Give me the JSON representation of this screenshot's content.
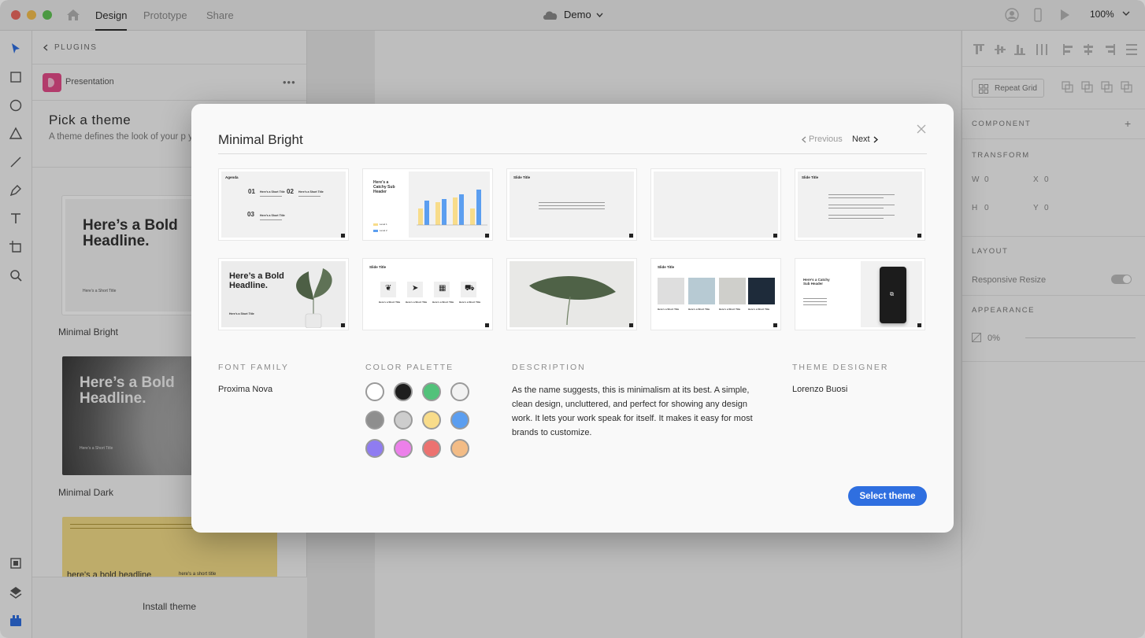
{
  "titlebar": {
    "tabs": [
      "Design",
      "Prototype",
      "Share"
    ],
    "document": "Demo",
    "zoom": "100%"
  },
  "plugin_panel": {
    "back_label": "PLUGINS",
    "plugin_name": "Presentation",
    "more": "•••",
    "pick_title": "Pick a theme",
    "pick_description": "A theme defines the look of your p your theme at any time.",
    "themes": [
      {
        "name": "Minimal Bright",
        "headline": "Here’s a Bold Headline.",
        "subtitle": "Here’s a Short Title"
      },
      {
        "name": "Minimal Dark",
        "headline": "Here’s a Bold Headline.",
        "subtitle": "Here’s a Short Title"
      },
      {
        "name": "",
        "headline": "here's a bold headline",
        "subtitle": "here's a short title"
      }
    ],
    "install_label": "Install theme"
  },
  "right_panel": {
    "repeat_grid": "Repeat Grid",
    "component": "COMPONENT",
    "transform": "TRANSFORM",
    "w_label": "W",
    "w_value": "0",
    "x_label": "X",
    "x_value": "0",
    "h_label": "H",
    "h_value": "0",
    "y_label": "Y",
    "y_value": "0",
    "layout": "LAYOUT",
    "responsive_resize": "Responsive Resize",
    "appearance": "APPEARANCE",
    "opacity": "0%"
  },
  "modal": {
    "title": "Minimal Bright",
    "prev_label": "Previous",
    "next_label": "Next",
    "slides": {
      "agenda_title": "Agenda",
      "agenda_items": [
        "01",
        "02",
        "03"
      ],
      "agenda_item_title": "Here’s a Short Title",
      "chart_header": "Here’s a Catchy Sub Header",
      "chart_legend": [
        "Level 1",
        "Level 2"
      ],
      "slide_title": "Slide Title",
      "bold_headline": "Here’s a Bold Headline.",
      "bold_sub": "Here’s a Short Title",
      "icon_item_title": "Here’s a Short Title"
    },
    "font_family_label": "FONT FAMILY",
    "font_family": "Proxima Nova",
    "palette_label": "COLOR PALETTE",
    "palette": [
      "#ffffff",
      "#1e1e1e",
      "#52c27a",
      "#f2f2f2",
      "#8e8e8e",
      "#cdcdcd",
      "#f8dc8a",
      "#5b9ef0",
      "#8f7cf1",
      "#ec80ea",
      "#ec7270",
      "#f3bc86"
    ],
    "description_label": "DESCRIPTION",
    "description": "As the name suggests, this is minimalism at its best. A simple, clean design, uncluttered, and perfect for showing any design work. It lets your work speak for itself. It makes it easy for most brands to customize.",
    "designer_label": "THEME DESIGNER",
    "designer": "Lorenzo Buosi",
    "select_label": "Select theme"
  }
}
